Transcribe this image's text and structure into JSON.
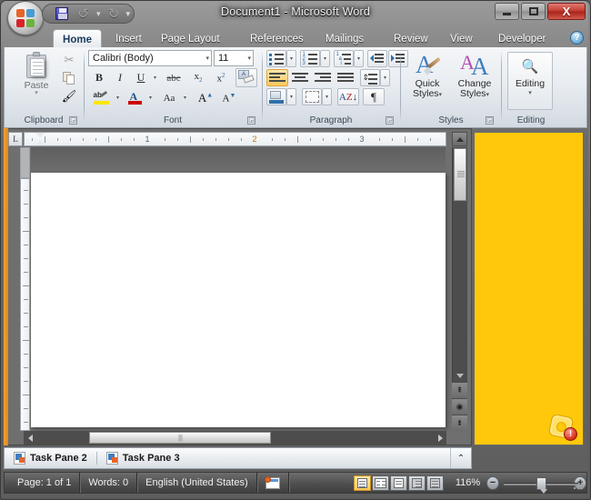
{
  "window": {
    "title": "Document1 - Microsoft Word",
    "office_button": "office-orb",
    "minimize_label": "Minimize",
    "restore_label": "Restore",
    "close_label": "X"
  },
  "quick_access": {
    "save_label": "Save",
    "undo_label": "Undo",
    "undo_dropdown": "▾",
    "redo_label": "Redo",
    "customize_label": "▾"
  },
  "tabs": [
    {
      "label": "Home",
      "active": true
    },
    {
      "label": "Insert",
      "active": false
    },
    {
      "label": "Page Layout",
      "active": false
    },
    {
      "label": "References",
      "active": false
    },
    {
      "label": "Mailings",
      "active": false
    },
    {
      "label": "Review",
      "active": false
    },
    {
      "label": "View",
      "active": false
    },
    {
      "label": "Developer",
      "active": false
    }
  ],
  "help_button": "?",
  "ribbon": {
    "clipboard": {
      "label": "Clipboard",
      "paste_label": "Paste",
      "paste_arrow": "▾",
      "cut_label": "Cut",
      "copy_label": "Copy",
      "format_painter_label": "Format Painter",
      "dialog_launcher": "◲"
    },
    "font": {
      "label": "Font",
      "font_name": "Calibri (Body)",
      "font_size": "11",
      "arrow": "▾",
      "bold": "B",
      "italic": "I",
      "underline": "U",
      "strikethrough": "abc",
      "subscript": "x",
      "subscript_index": "2",
      "superscript": "x",
      "superscript_index": "2",
      "clear_formatting": "Clear Formatting",
      "highlight": "ab",
      "font_color": "A",
      "change_case": "Aa",
      "grow_font": "A",
      "shrink_font": "A",
      "dialog_launcher": "◲"
    },
    "paragraph": {
      "label": "Paragraph",
      "bullets": "Bullets",
      "numbering": "Numbering",
      "multilevel": "Multilevel List",
      "decrease_indent": "Decrease Indent",
      "increase_indent": "Increase Indent",
      "align_left": "Align Left",
      "align_center": "Center",
      "align_right": "Align Right",
      "justify": "Justify",
      "line_spacing": "Line Spacing",
      "shading": "Shading",
      "borders": "Borders",
      "sort_a": "A",
      "sort_z": "Z",
      "sort_arrow": "↓",
      "show_marks": "¶",
      "dialog_launcher": "◲"
    },
    "styles": {
      "label": "Styles",
      "quick_styles_line1": "Quick",
      "quick_styles_line2": "Styles",
      "change_styles_line1": "Change",
      "change_styles_line2": "Styles",
      "arrow": "▾",
      "glyph": "A",
      "dialog_launcher": "◲"
    },
    "editing": {
      "label": "Editing",
      "button_label": "Editing",
      "arrow": "▾"
    }
  },
  "ruler": {
    "tab_stop_selector": "L",
    "numbers": [
      "1",
      "2",
      "3"
    ]
  },
  "task_panes": {
    "items": [
      {
        "label": "Task Pane 2"
      },
      {
        "label": "Task Pane 3"
      }
    ],
    "collapse_label": "⌃"
  },
  "side_pane": {
    "color": "#ffc80a",
    "badge_text": "!"
  },
  "status_bar": {
    "page": "Page: 1 of 1",
    "words": "Words: 0",
    "language": "English (United States)",
    "proofing_icon": "proofing-errors-icon",
    "views": [
      {
        "name": "print-layout",
        "active": true
      },
      {
        "name": "full-screen-reading",
        "active": false
      },
      {
        "name": "web-layout",
        "active": false
      },
      {
        "name": "outline",
        "active": false
      },
      {
        "name": "draft",
        "active": false
      }
    ],
    "zoom": "116%",
    "zoom_out": "−",
    "zoom_in": "+"
  },
  "scrollbars": {
    "v_up": "▲",
    "v_down": "▼",
    "h_left": "◀",
    "h_right": "▶",
    "browse_prev": "⇞",
    "browse_object": "◉",
    "browse_next": "⇟"
  }
}
